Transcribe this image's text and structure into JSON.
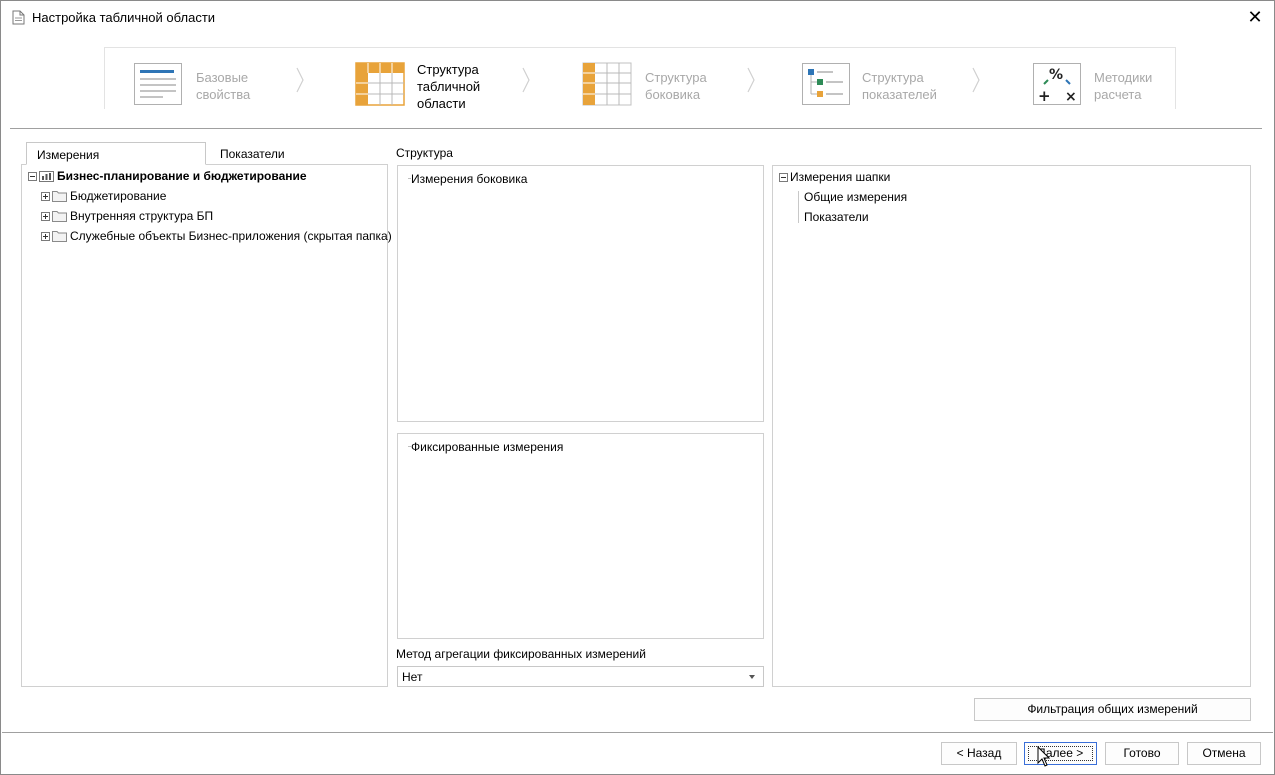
{
  "window": {
    "title": "Настройка табличной области",
    "close_glyph": "✕"
  },
  "steps": [
    {
      "line1": "Базовые",
      "line2": "свойства",
      "line3": "",
      "icon": "base-properties-icon",
      "active": false
    },
    {
      "line1": "Структура",
      "line2": "табличной",
      "line3": "области",
      "icon": "table-structure-icon",
      "active": true
    },
    {
      "line1": "Структура",
      "line2": "боковика",
      "line3": "",
      "icon": "sidebar-structure-icon",
      "active": false
    },
    {
      "line1": "Структура",
      "line2": "показателей",
      "line3": "",
      "icon": "indicators-structure-icon",
      "active": false
    },
    {
      "line1": "Методики",
      "line2": "расчета",
      "line3": "",
      "icon": "calculation-methods-icon",
      "active": false
    }
  ],
  "tabs": {
    "dimensions": "Измерения",
    "indicators": "Показатели"
  },
  "tree": {
    "root": "Бизнес-планирование и бюджетирование",
    "children": [
      "Бюджетирование",
      "Внутренняя структура БП",
      "Служебные объекты Бизнес-приложения (скрытая папка)"
    ]
  },
  "structure": {
    "label": "Структура",
    "side_dims": "Измерения боковика",
    "fixed_dims": "Фиксированные измерения",
    "header": {
      "root": "Измерения шапки",
      "children": [
        "Общие измерения",
        "Показатели"
      ]
    }
  },
  "aggregation": {
    "label": "Метод агрегации фиксированных измерений",
    "value": "Нет"
  },
  "buttons": {
    "filter": "Фильтрация общих измерений",
    "back": "< Назад",
    "next": "Далее >",
    "done": "Готово",
    "cancel": "Отмена"
  },
  "colors": {
    "accent_orange": "#e8a33a",
    "accent_blue": "#2e75b6",
    "accent_green": "#2e8b57"
  }
}
